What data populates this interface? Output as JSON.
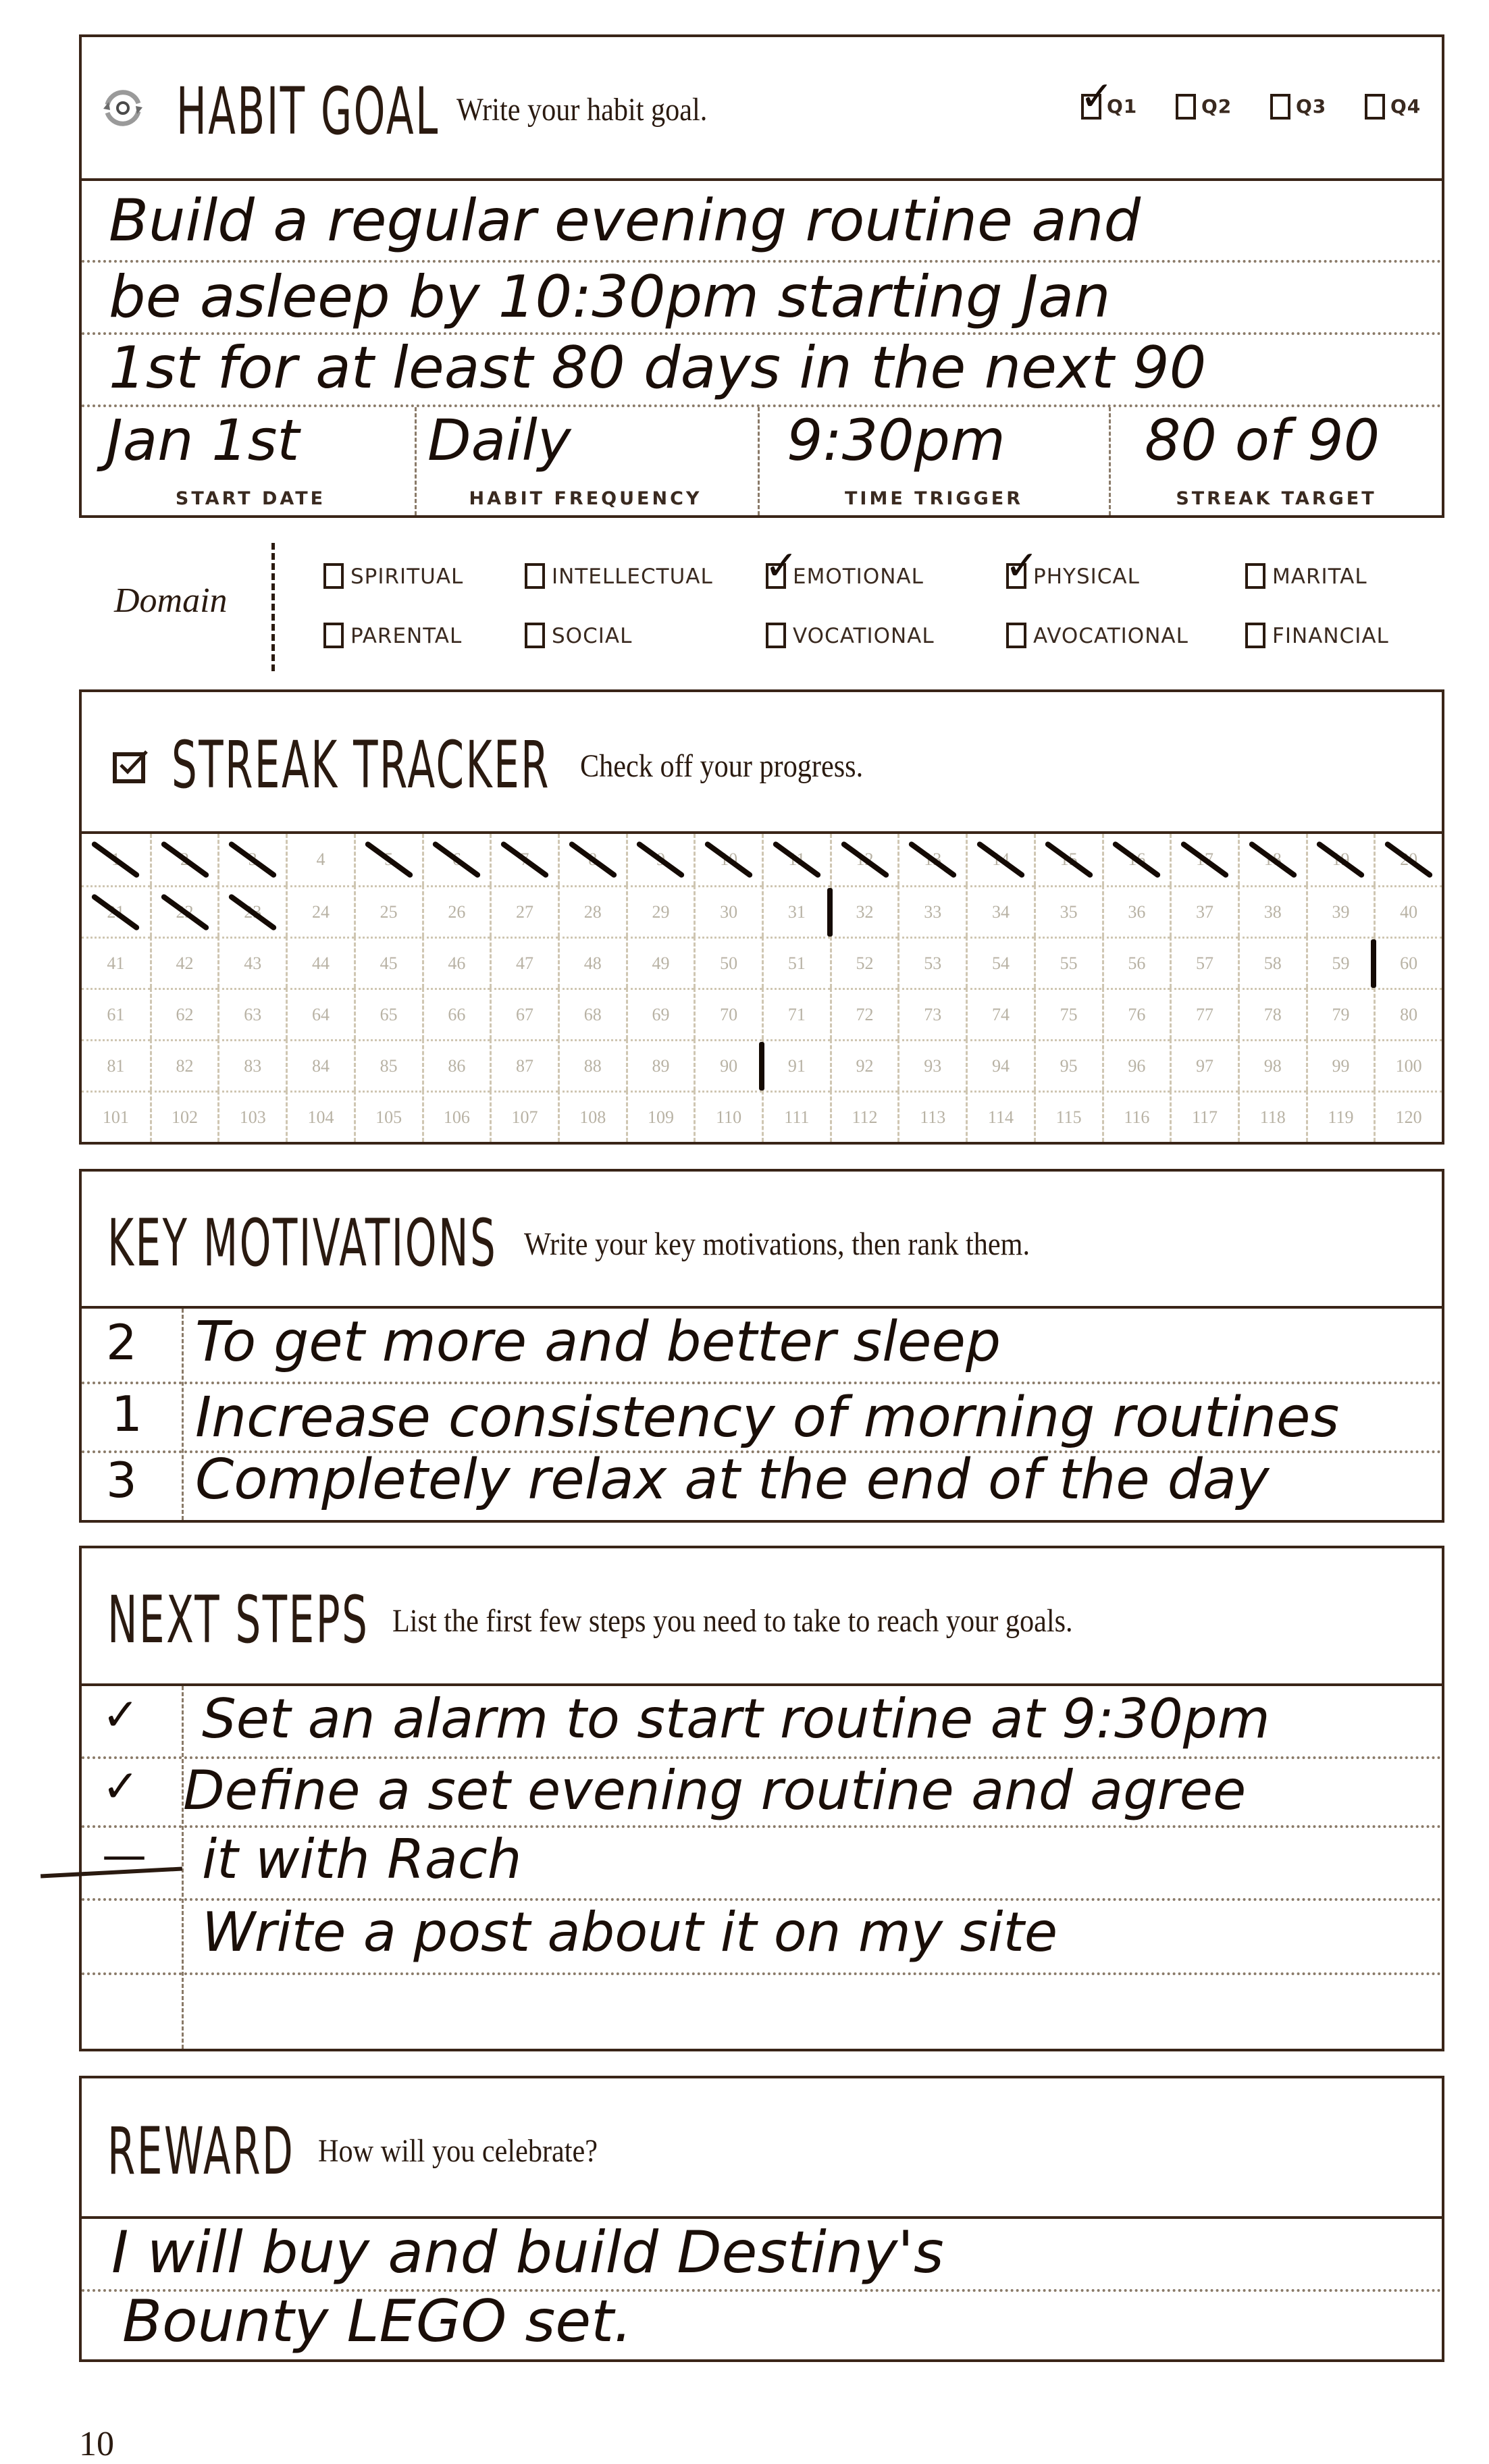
{
  "habit_goal": {
    "title": "HABIT GOAL",
    "subtitle": "Write your habit goal.",
    "icon": "cycle-arrows-icon",
    "quarters": [
      {
        "label": "Q1",
        "checked": true
      },
      {
        "label": "Q2",
        "checked": false
      },
      {
        "label": "Q3",
        "checked": false
      },
      {
        "label": "Q4",
        "checked": false
      }
    ],
    "goal_lines": [
      "Build a regular evening routine and",
      "be asleep by 10:30pm starting Jan",
      "1st for at least 80 days in the next 90"
    ],
    "fields": [
      {
        "label": "START DATE",
        "value": "Jan 1st"
      },
      {
        "label": "HABIT FREQUENCY",
        "value": "Daily"
      },
      {
        "label": "TIME TRIGGER",
        "value": "9:30pm"
      },
      {
        "label": "STREAK TARGET",
        "value": "80 of 90"
      }
    ]
  },
  "domain": {
    "label": "Domain",
    "options": [
      {
        "label": "SPIRITUAL",
        "checked": false
      },
      {
        "label": "INTELLECTUAL",
        "checked": false
      },
      {
        "label": "EMOTIONAL",
        "checked": true
      },
      {
        "label": "PHYSICAL",
        "checked": true
      },
      {
        "label": "MARITAL",
        "checked": false
      },
      {
        "label": "PARENTAL",
        "checked": false
      },
      {
        "label": "SOCIAL",
        "checked": false
      },
      {
        "label": "VOCATIONAL",
        "checked": false
      },
      {
        "label": "AVOCATIONAL",
        "checked": false
      },
      {
        "label": "FINANCIAL",
        "checked": false
      }
    ]
  },
  "streak_tracker": {
    "title": "STREAK TRACKER",
    "subtitle": "Check off your progress.",
    "icon": "checkbox-icon",
    "total_days": 120,
    "columns": 20,
    "checked_days": [
      1,
      2,
      3,
      5,
      6,
      7,
      8,
      9,
      10,
      11,
      12,
      13,
      14,
      15,
      16,
      17,
      18,
      19,
      20,
      21,
      22,
      23
    ],
    "divider_after_days": [
      31,
      59,
      90
    ]
  },
  "key_motivations": {
    "title": "KEY MOTIVATIONS",
    "subtitle": "Write your key motivations, then rank them.",
    "items": [
      {
        "rank": "2",
        "text": "To get more and better sleep"
      },
      {
        "rank": "1",
        "text": "Increase consistency of morning routines"
      },
      {
        "rank": "3",
        "text": "Completely relax at the end of the day"
      }
    ]
  },
  "next_steps": {
    "title": "NEXT STEPS",
    "subtitle": "List the first few steps you need to take to reach your goals.",
    "lines": [
      {
        "mark": "✓",
        "text": "Set an alarm to start routine at 9:30pm"
      },
      {
        "mark": "✓",
        "text": "Define a set evening routine and agree"
      },
      {
        "mark": "—",
        "text": "it with Rach"
      },
      {
        "mark": "",
        "text": "Write a post about it on my site"
      },
      {
        "mark": "",
        "text": ""
      }
    ]
  },
  "reward": {
    "title": "REWARD",
    "subtitle": "How will you celebrate?",
    "lines": [
      "I will buy and build Destiny's",
      "Bounty LEGO set."
    ]
  },
  "page_number": "10"
}
